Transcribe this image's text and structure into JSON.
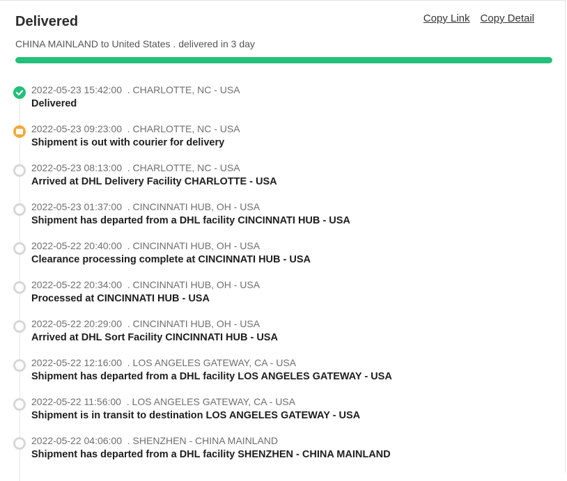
{
  "header": {
    "status": "Delivered",
    "copy_link_label": "Copy Link",
    "copy_detail_label": "Copy Detail",
    "route_summary": "CHINA MAINLAND to United States . delivered in 3 day"
  },
  "progress": {
    "percent": 100,
    "color": "#22c07a"
  },
  "colors": {
    "delivered": "#22c07a",
    "in_progress": "#f5a83c",
    "pending": "#d7d7d7"
  },
  "events": [
    {
      "datetime": "2022-05-23 15:42:00",
      "location": ". CHARLOTTE, NC - USA",
      "description": "Delivered",
      "status": "done",
      "icon": "check-circle-icon"
    },
    {
      "datetime": "2022-05-23 09:23:00",
      "location": ". CHARLOTTE, NC - USA",
      "description": "Shipment is out with courier for delivery",
      "status": "active",
      "icon": "delivery-truck-icon"
    },
    {
      "datetime": "2022-05-23 08:13:00",
      "location": ". CHARLOTTE, NC - USA",
      "description": "Arrived at DHL Delivery Facility CHARLOTTE - USA",
      "status": "pending",
      "icon": "circle-icon"
    },
    {
      "datetime": "2022-05-23 01:37:00",
      "location": ". CINCINNATI HUB, OH - USA",
      "description": "Shipment has departed from a DHL facility CINCINNATI HUB - USA",
      "status": "pending",
      "icon": "circle-icon"
    },
    {
      "datetime": "2022-05-22 20:40:00",
      "location": ". CINCINNATI HUB, OH - USA",
      "description": "Clearance processing complete at CINCINNATI HUB - USA",
      "status": "pending",
      "icon": "circle-icon"
    },
    {
      "datetime": "2022-05-22 20:34:00",
      "location": ". CINCINNATI HUB, OH - USA",
      "description": "Processed at CINCINNATI HUB - USA",
      "status": "pending",
      "icon": "circle-icon"
    },
    {
      "datetime": "2022-05-22 20:29:00",
      "location": ". CINCINNATI HUB, OH - USA",
      "description": "Arrived at DHL Sort Facility CINCINNATI HUB - USA",
      "status": "pending",
      "icon": "circle-icon"
    },
    {
      "datetime": "2022-05-22 12:16:00",
      "location": ". LOS ANGELES GATEWAY, CA - USA",
      "description": "Shipment has departed from a DHL facility LOS ANGELES GATEWAY - USA",
      "status": "pending",
      "icon": "circle-icon"
    },
    {
      "datetime": "2022-05-22 11:56:00",
      "location": ". LOS ANGELES GATEWAY, CA - USA",
      "description": "Shipment is in transit to destination LOS ANGELES GATEWAY - USA",
      "status": "pending",
      "icon": "circle-icon"
    },
    {
      "datetime": "2022-05-22 04:06:00",
      "location": ". SHENZHEN - CHINA MAINLAND",
      "description": "Shipment has departed from a DHL facility SHENZHEN - CHINA MAINLAND",
      "status": "pending",
      "icon": "circle-icon"
    }
  ]
}
